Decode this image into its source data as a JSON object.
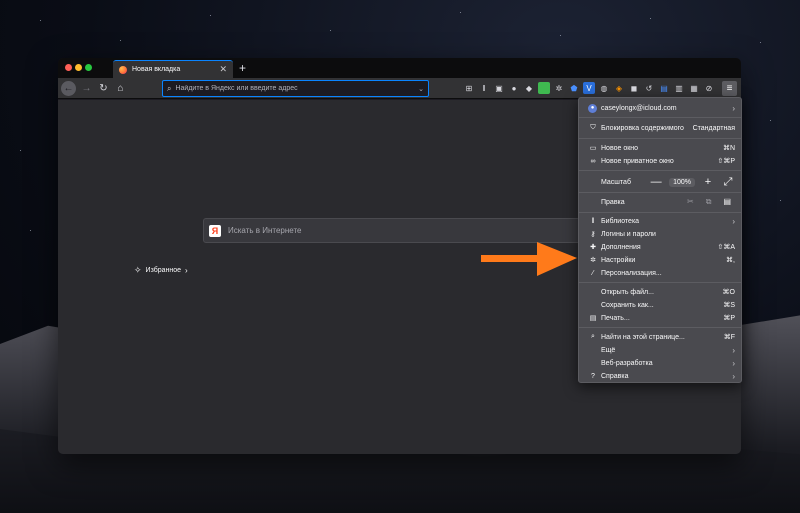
{
  "tab": {
    "title": "Новая вкладка",
    "close": "✕"
  },
  "new_tab_label": "+",
  "urlbar": {
    "placeholder": "Найдите в Яндекс или введите адрес"
  },
  "newtab_page": {
    "search_placeholder": "Искать в Интернете",
    "search_logo": "Я",
    "favorites_label": "Избранное"
  },
  "menu": {
    "account_email": "caseylongx@icloud.com",
    "content_blocking": {
      "label": "Блокировка содержимого",
      "value": "Стандартная"
    },
    "new_window": {
      "label": "Новое окно",
      "shortcut": "⌘N"
    },
    "private_window": {
      "label": "Новое приватное окно",
      "shortcut": "⇧⌘P"
    },
    "zoom": {
      "label": "Масштаб",
      "minus": "—",
      "value": "100%",
      "plus": "+",
      "fullscreen": "⤢"
    },
    "edit": {
      "label": "Правка"
    },
    "library": {
      "label": "Библиотека"
    },
    "logins": {
      "label": "Логины и пароли"
    },
    "addons": {
      "label": "Дополнения",
      "shortcut": "⇧⌘A"
    },
    "preferences": {
      "label": "Настройки",
      "shortcut": "⌘,"
    },
    "customize": {
      "label": "Персонализация..."
    },
    "open_file": {
      "label": "Открыть файл...",
      "shortcut": "⌘O"
    },
    "save_page": {
      "label": "Сохранить как...",
      "shortcut": "⌘S"
    },
    "print": {
      "label": "Печать...",
      "shortcut": "⌘P"
    },
    "find": {
      "label": "Найти на этой странице...",
      "shortcut": "⌘F"
    },
    "more": {
      "label": "Ещё"
    },
    "web_developer": {
      "label": "Веб-разработка"
    },
    "help": {
      "label": "Справка"
    }
  },
  "colors": {
    "accent": "#0a84ff",
    "arrow": "#ff7a1a",
    "menu_bg": "#4a4a4f"
  },
  "icons": [
    "back-icon",
    "forward-icon",
    "reload-icon",
    "home-icon",
    "search-icon",
    "hamburger-menu-icon"
  ]
}
